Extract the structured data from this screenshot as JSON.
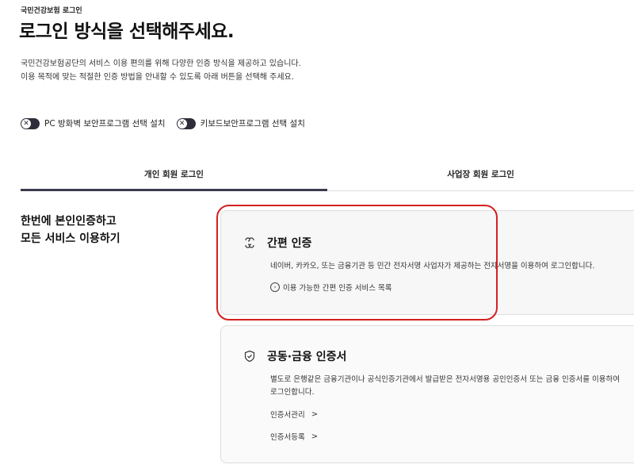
{
  "breadcrumb": "국민건강보험 로그인",
  "title": "로그인 방식을 선택해주세요.",
  "description": [
    "국민건강보험공단의 서비스 이용 편의를 위해 다양한 인증 방식을 제공하고 있습니다.",
    "이용 목적에 맞는 적절한 인증 방법을 안내할 수 있도록 아래 버튼을 선택해 주세요."
  ],
  "toggles": [
    {
      "label": "PC 방화벽 보안프로그램 선택 설치",
      "icon": "x-icon"
    },
    {
      "label": "키보드보안프로그램 선택 설치",
      "icon": "x-icon"
    }
  ],
  "tabs": [
    {
      "label": "개인 회원 로그인",
      "active": true
    },
    {
      "label": "사업장 회원 로그인",
      "active": false
    }
  ],
  "section": {
    "line1": "한번에 본인인증하고",
    "line2": "모든 서비스 이용하기"
  },
  "cards": {
    "simple": {
      "icon": "link-icon",
      "title": "간편 인증",
      "text": "네이버, 카카오, 또는 금융기관 등 민간 전자서명 사업자가 제공하는 전자서명을 이용하여 로그인합니다.",
      "link": "이용 가능한 간편 인증 서비스 목록"
    },
    "cert": {
      "icon": "shield-check-icon",
      "title": "공동·금융 인증서",
      "text": "별도로 은행같은 금융기관이나 공식인증기관에서 발급받은 전자서명용 공인인증서 또는 금융 인증서를 이용하여 로그인합니다.",
      "links": [
        "인증서관리",
        "인증서등록"
      ],
      "link_arrow": ">"
    }
  },
  "colors": {
    "highlight": "#d42020",
    "tab_active": "#3b3b4f",
    "toggle": "#2e2e3a"
  }
}
